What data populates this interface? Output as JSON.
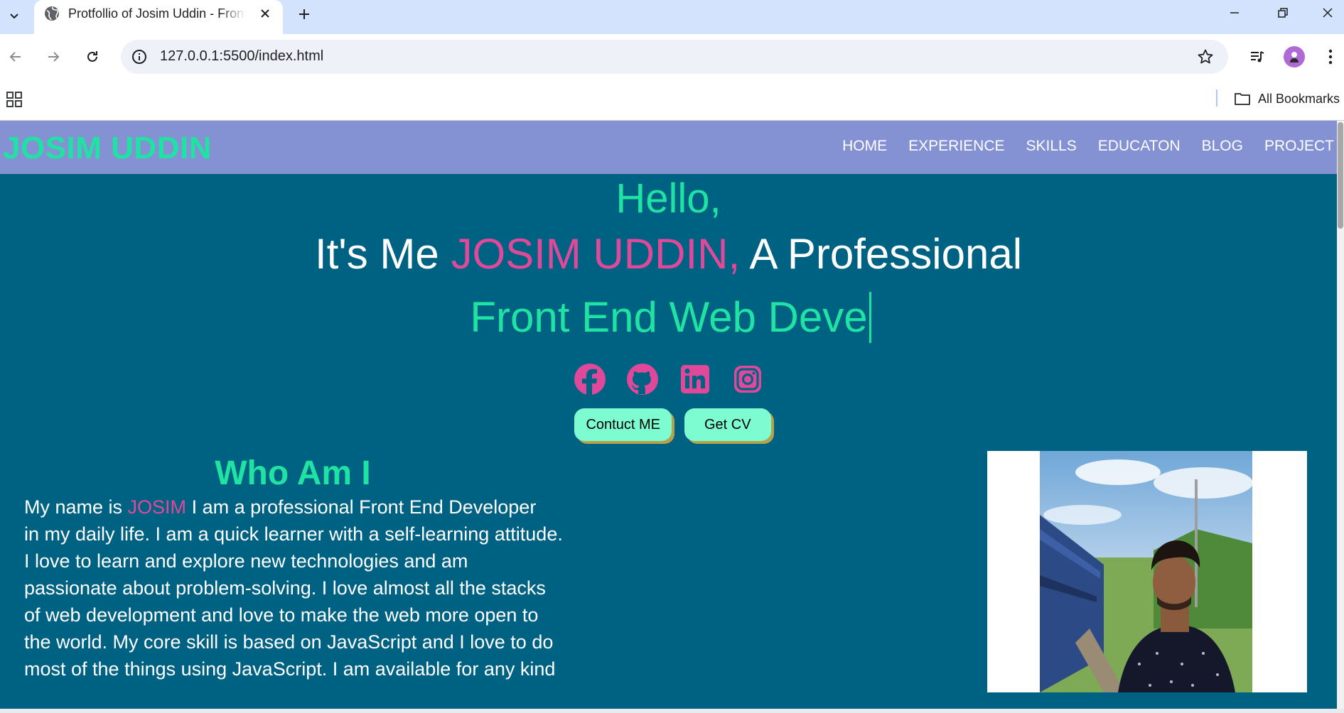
{
  "browser": {
    "tab_title": "Protfollio of Josim Uddin - Front End Web Developer",
    "url": "127.0.0.1:5500/index.html",
    "bookmarks_label": "All Bookmarks"
  },
  "site": {
    "brand": "JOSIM UDDIN",
    "nav": [
      "HOME",
      "EXPERIENCE",
      "SKILLS",
      "EDUCATON",
      "BLOG",
      "PROJECT"
    ]
  },
  "hero": {
    "hello": "Hello,",
    "intro_prefix": "It's Me ",
    "intro_name": "JOSIM UDDIN,",
    "intro_suffix": " A Professional",
    "typed": "Front End Web Deve",
    "social_icons": [
      "facebook-icon",
      "github-icon",
      "linkedin-icon",
      "instagram-icon"
    ],
    "buttons": {
      "contact": "Contuct ME",
      "cv": "Get CV"
    }
  },
  "about": {
    "title": "Who Am I",
    "lines": [
      {
        "pre": "My name is ",
        "name": "JOSIM",
        "post": " I am a professional Front End Developer"
      },
      {
        "pre": "in my daily life. I am a quick learner with a self-learning attitude."
      },
      {
        "pre": "I love to learn and explore new technologies and am"
      },
      {
        "pre": "passionate about problem-solving. I love almost all the stacks"
      },
      {
        "pre": "of web development and love to make the web more open to"
      },
      {
        "pre": "the world. My core skill is based on JavaScript and I love to do"
      },
      {
        "pre": "most of the things using JavaScript. I am available for any kind"
      }
    ]
  },
  "colors": {
    "page_bg": "#006283",
    "header_bg": "#8492d3",
    "accent_green": "#1ee3a3",
    "accent_pink": "#e0499a",
    "button_bg": "#7dfcd1"
  }
}
